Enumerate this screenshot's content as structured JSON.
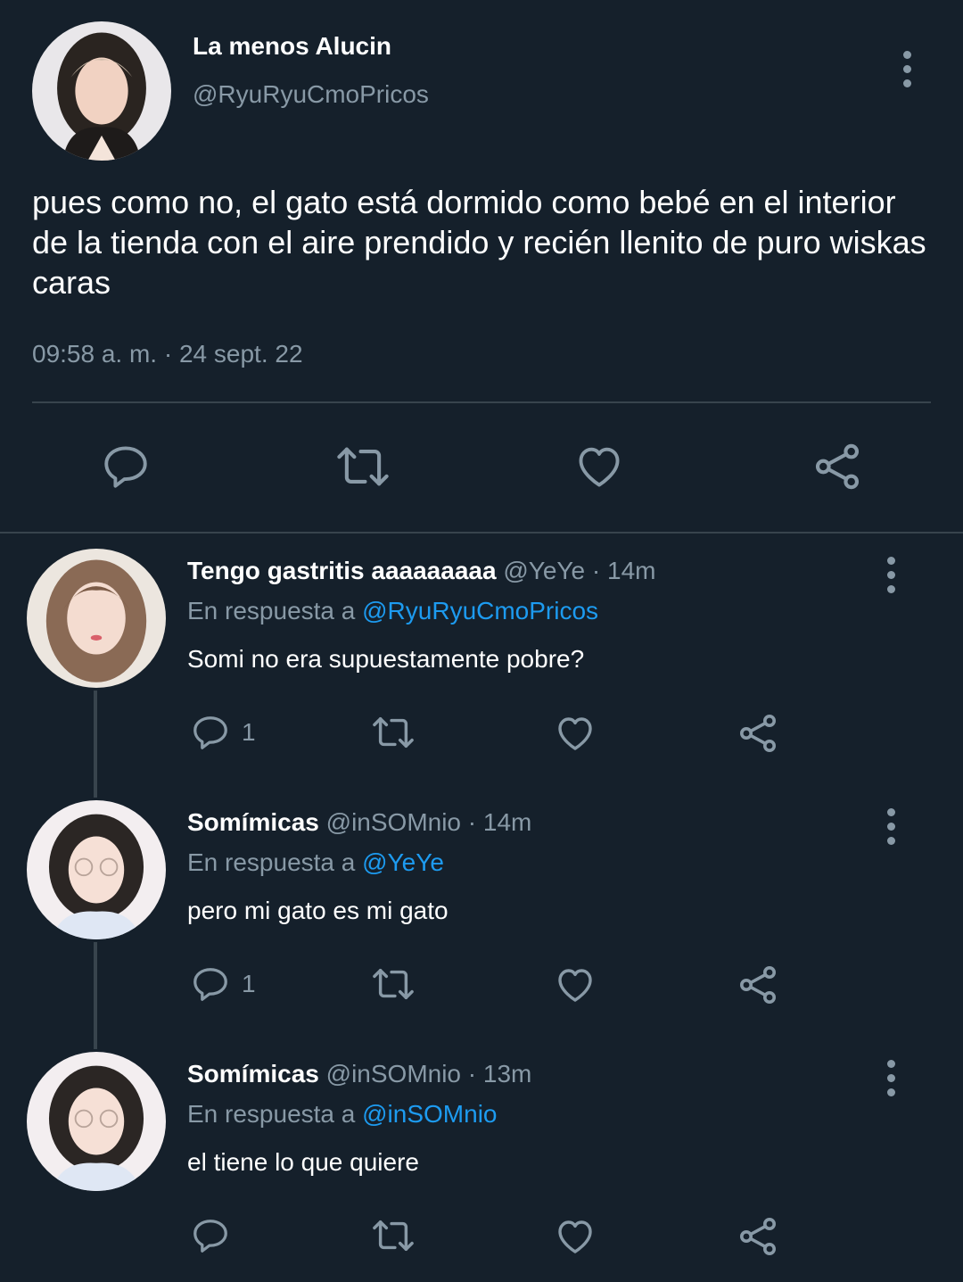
{
  "main_tweet": {
    "display_name": "La menos Alucin",
    "handle": "@RyuRyuCmoPricos",
    "text": "pues como no, el gato está dormido como bebé en el interior de la tienda con el aire prendido y recién llenito de puro wiskas caras",
    "timestamp": "09:58 a. m. · 24 sept. 22",
    "icons": {
      "more": "more-vertical-icon",
      "reply": "reply-icon",
      "retweet": "retweet-icon",
      "like": "heart-icon",
      "share": "share-icon"
    }
  },
  "replies": [
    {
      "display_name": "Tengo gastritis aaaaaaaaa",
      "handle": "@YeYe",
      "time": "· 14m",
      "reply_prefix": "En respuesta a",
      "reply_to": "@RyuRyuCmoPricos",
      "text": "Somi no era supuestamente pobre?",
      "reply_count": "1"
    },
    {
      "display_name": "Somímicas",
      "handle": "@inSOMnio",
      "time": "· 14m",
      "reply_prefix": "En respuesta a",
      "reply_to": "@YeYe",
      "text": "pero mi gato es mi gato",
      "reply_count": "1"
    },
    {
      "display_name": "Somímicas",
      "handle": "@inSOMnio",
      "time": "· 13m",
      "reply_prefix": "En respuesta a",
      "reply_to": "@inSOMnio",
      "text": "el tiene lo que quiere",
      "reply_count": ""
    }
  ],
  "colors": {
    "background": "#15202b",
    "text": "#ffffff",
    "muted": "#8899a6",
    "link": "#1d9bf0",
    "divider": "#38444d"
  }
}
